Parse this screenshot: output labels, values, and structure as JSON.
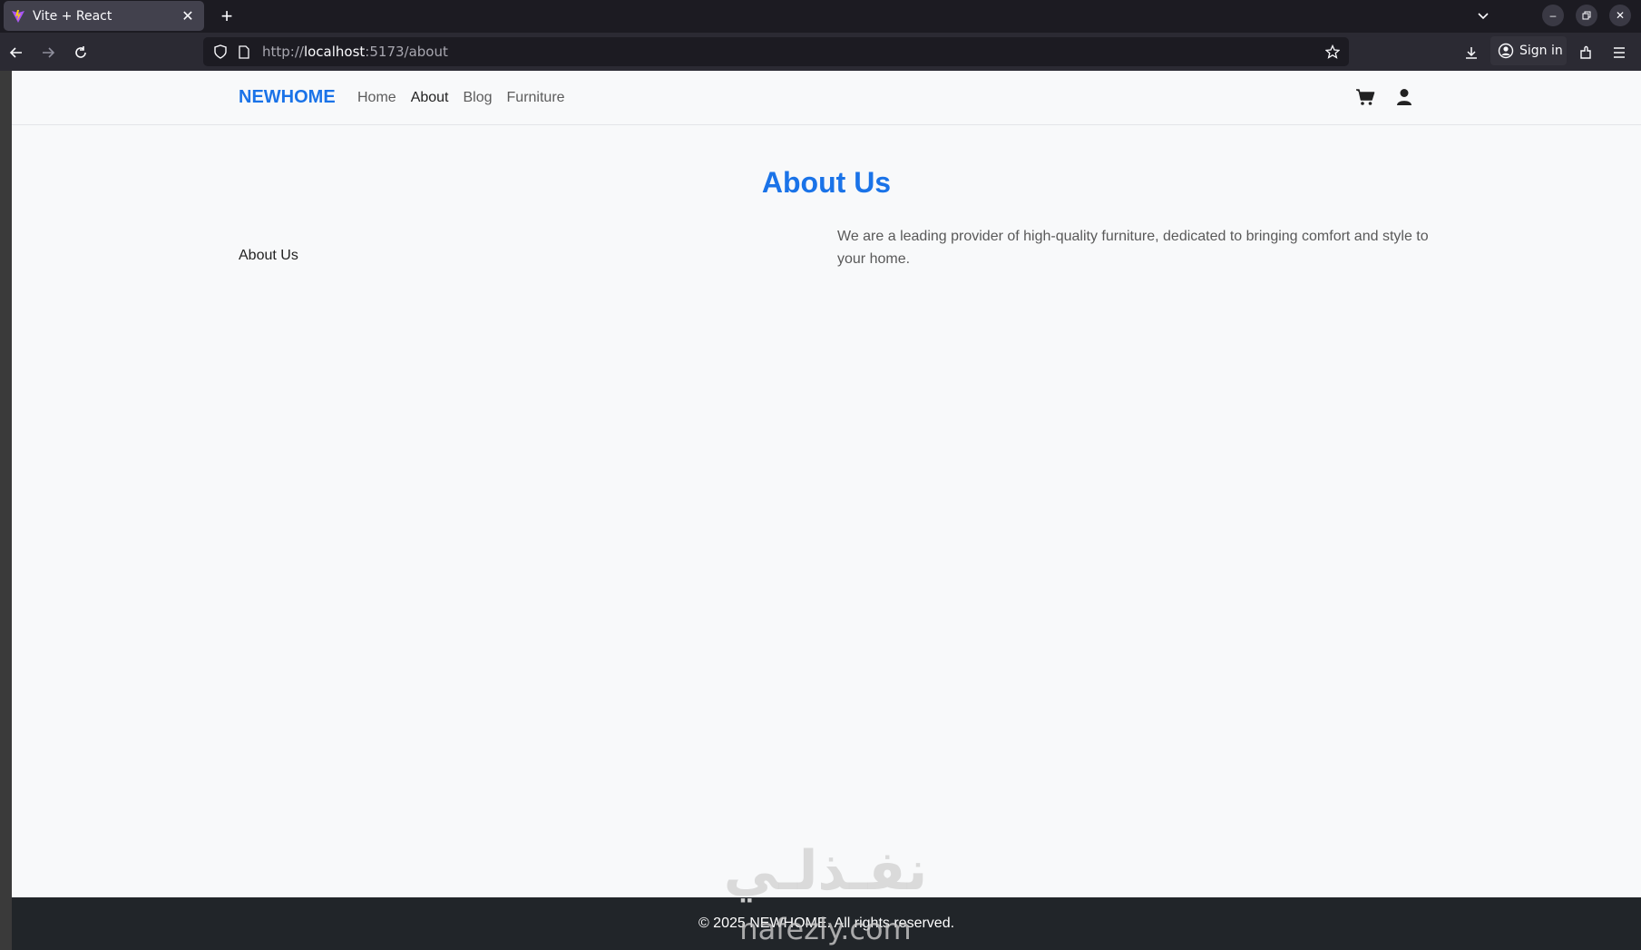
{
  "browser": {
    "tab_title": "Vite + React",
    "url_prefix": "http://",
    "url_host": "localhost",
    "url_rest": ":5173/about",
    "sign_in_label": "Sign in"
  },
  "site": {
    "brand": "NEWHOME",
    "nav": [
      {
        "label": "Home",
        "active": false
      },
      {
        "label": "About",
        "active": true
      },
      {
        "label": "Blog",
        "active": false
      },
      {
        "label": "Furniture",
        "active": false
      }
    ],
    "icons": [
      "cart-icon",
      "user-icon"
    ],
    "accent_color": "#1a73e8"
  },
  "page": {
    "title": "About Us",
    "left_label": "About Us",
    "text": "We are a leading provider of high-quality furniture, dedicated to bringing comfort and style to your home."
  },
  "footer": {
    "text": "© 2025 NEWHOME. All rights reserved."
  },
  "watermark": {
    "top": "نفـذلـي",
    "bottom": "nafezly.com"
  }
}
